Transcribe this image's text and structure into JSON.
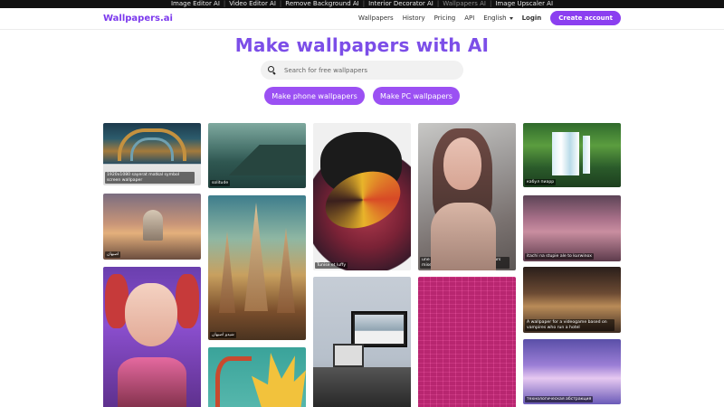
{
  "topbar": {
    "links": [
      {
        "label": "Image Editor AI",
        "active": false
      },
      {
        "label": "Video Editor AI",
        "active": false
      },
      {
        "label": "Remove Background AI",
        "active": false
      },
      {
        "label": "Interior Decorator AI",
        "active": false
      },
      {
        "label": "Wallpapers AI",
        "active": true
      },
      {
        "label": "Image Upscaler AI",
        "active": false
      }
    ]
  },
  "header": {
    "logo": "Wallpapers.ai",
    "nav": {
      "wallpapers": "Wallpapers",
      "history": "History",
      "pricing": "Pricing",
      "api": "API",
      "language": "English",
      "login": "Login",
      "create_account": "Create account"
    }
  },
  "hero": {
    "title": "Make wallpapers with AI",
    "search_placeholder": "Search for free wallpapers",
    "phone_button": "Make phone wallpapers",
    "pc_button": "Make PC wallpapers"
  },
  "gallery": {
    "captions": {
      "t1": "1920x1080 sayerat matkal symbol screen wallpaper",
      "t2": "solitude",
      "t3": "Tunise et luffy",
      "t4": "une fille brisée, abandonnée, toujours mise de côté par les autres",
      "t5": "кабул пиарр",
      "t6": "اصبهان",
      "t7": "شیدو اصبهان",
      "t8": "itachi na stupie ale to kurwinox",
      "t12": "A wallpaper for a videogame based on vampires who run a hotel",
      "t13": "технологическая абстракция"
    }
  },
  "colors": {
    "brand": "#7c3aed",
    "accent_button": "#8b3ff0",
    "pill": "#9b50f3"
  }
}
